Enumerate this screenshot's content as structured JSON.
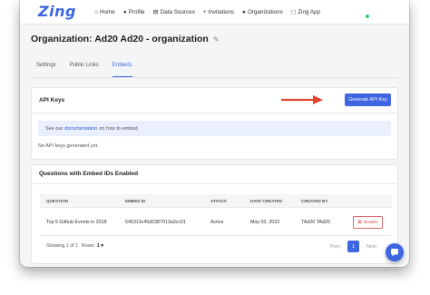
{
  "app": {
    "logo_text": "Zing",
    "brand_color": "#3d66e0",
    "status_color": "#2ecc71"
  },
  "nav": {
    "items": [
      {
        "icon": "home-icon",
        "glyph": "⌂",
        "label": "Home"
      },
      {
        "icon": "person-icon",
        "glyph": "●",
        "label": "Profile"
      },
      {
        "icon": "database-icon",
        "glyph": "▤",
        "label": "Data Sources"
      },
      {
        "icon": "add-person-icon",
        "glyph": "+",
        "label": "Invitations"
      },
      {
        "icon": "people-icon",
        "glyph": "●",
        "label": "Organizations"
      },
      {
        "icon": "zing-app-icon",
        "glyph": "◻",
        "label": "Zing App"
      }
    ]
  },
  "page": {
    "title": "Organization: Ad20 Ad20 - organization"
  },
  "tabs": [
    {
      "label": "Settings",
      "active": false
    },
    {
      "label": "Public Links",
      "active": false
    },
    {
      "label": "Embeds",
      "active": true
    }
  ],
  "api_keys": {
    "title": "API Keys",
    "generate_label": "Generate API Key",
    "info_prefix": "See our",
    "info_link": "documentation",
    "info_suffix": "on how to embed.",
    "empty_text": "No API keys generated yet."
  },
  "questions": {
    "title": "Questions with Embed IDs Enabled",
    "columns": [
      "QUESTION",
      "EMBED ID",
      "STATUS",
      "DATE CREATED",
      "CREATED BY"
    ],
    "rows": [
      {
        "question": "Top 5 Github Events in 2018",
        "embed_id": "645313c45d2387013a3cc01",
        "status": "Active",
        "date_created": "May 03, 2023",
        "created_by": "TAd20 TAd20",
        "action_label": "Disable"
      }
    ],
    "footer": {
      "showing": "Showing 1 of 1",
      "rows_label": "Rows:",
      "rows_value": "1",
      "prev_label": "Prev",
      "current_page": "1",
      "next_label": "Next"
    }
  }
}
